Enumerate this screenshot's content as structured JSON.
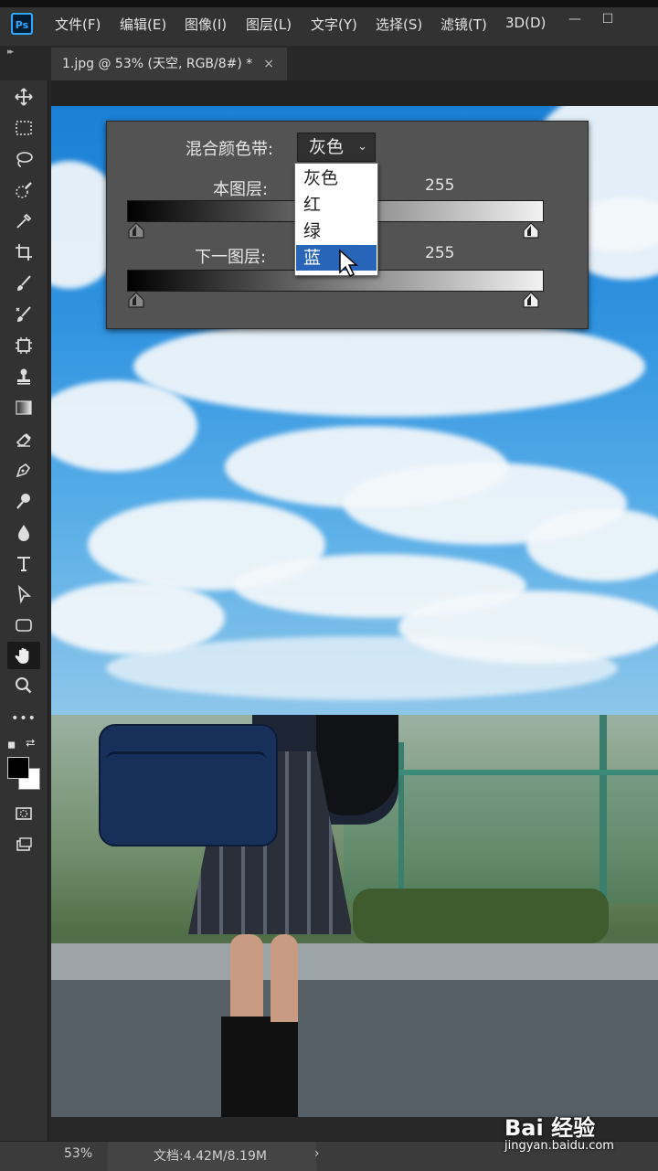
{
  "app": {
    "logo": "Ps"
  },
  "menu": [
    "文件(F)",
    "编辑(E)",
    "图像(I)",
    "图层(L)",
    "文字(Y)",
    "选择(S)",
    "滤镜(T)",
    "3D(D)"
  ],
  "window_controls": {
    "minimize": "—",
    "maximize": "☐"
  },
  "document_tab": {
    "title": "1.jpg @ 53% (天空, RGB/8#) *",
    "close": "×"
  },
  "toolbar": {
    "tools": [
      "move-tool",
      "marquee-tool",
      "lasso-tool",
      "quick-select-tool",
      "eyedropper-tool",
      "crop-tool",
      "brush-tool",
      "healing-brush-tool",
      "frame-tool",
      "clone-stamp-tool",
      "gradient-tool",
      "eraser-tool",
      "pen-tool",
      "dodge-tool",
      "blur-tool",
      "type-tool",
      "path-select-tool",
      "shape-tool",
      "hand-tool",
      "zoom-tool",
      "more-tools"
    ],
    "active_tool": "hand-tool",
    "more_label": "•••",
    "foreground_color": "#000000",
    "background_color": "#ffffff"
  },
  "blend_if": {
    "label": "混合颜色带:",
    "selected": "灰色",
    "options": [
      "灰色",
      "红",
      "绿",
      "蓝"
    ],
    "highlighted_option": "蓝",
    "this_layer": {
      "label": "本图层:",
      "max_value": "255"
    },
    "underlying_layer": {
      "label": "下一图层:",
      "max_value": "255"
    }
  },
  "status": {
    "zoom": "53%",
    "doc_info": "文档:4.42M/8.19M",
    "arrow": "›"
  },
  "watermark": {
    "brand": "Bai 经验",
    "url": "jingyan.baidu.com"
  },
  "colors": {
    "accent": "#31a8ff",
    "selection": "#2865b8",
    "panel": "#535353"
  }
}
